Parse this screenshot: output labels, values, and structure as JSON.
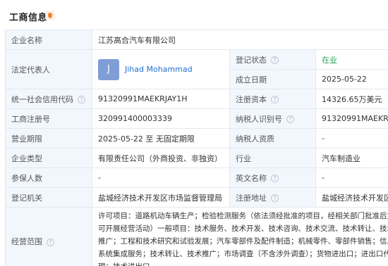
{
  "header": {
    "title": "工商信息",
    "icon": "info-badge-icon"
  },
  "rows": {
    "company_name": {
      "label": "企业名称",
      "value": "江苏高合汽车有限公司"
    },
    "legal_rep": {
      "label": "法定代表人",
      "avatar_letter": "J",
      "name": "Jihad Mohammad"
    },
    "reg_status": {
      "label": "登记状态",
      "value": "在业"
    },
    "established": {
      "label": "成立日期",
      "value": "2025-05-22"
    },
    "credit_code": {
      "label": "统一社会信用代码",
      "value": "91320991MAEKRJAY1H"
    },
    "reg_capital": {
      "label": "注册资本",
      "value": "14326.65万美元"
    },
    "reg_number": {
      "label": "工商注册号",
      "value": "320991400003339"
    },
    "taxpayer_id": {
      "label": "纳税人识别号",
      "value": "91320991MAEKRJAY1H"
    },
    "biz_term": {
      "label": "营业期限",
      "value": "2025-05-22 至 无固定期限"
    },
    "taxpayer_qual": {
      "label": "纳税人资质",
      "value": "-"
    },
    "company_type": {
      "label": "企业类型",
      "value": "有限责任公司（外商投资、非独资）"
    },
    "industry": {
      "label": "行业",
      "value": "汽车制造业"
    },
    "insured": {
      "label": "参保人数",
      "value": "-"
    },
    "english_name": {
      "label": "英文名称",
      "value": "-"
    },
    "reg_authority": {
      "label": "登记机关",
      "value": "盐城经济技术开发区市场监督管理局"
    },
    "reg_address": {
      "label": "注册地址",
      "value": "盐城经济技术开发区"
    },
    "biz_scope": {
      "label": "经营范围",
      "value": "许可项目：道路机动车辆生产；检验检测服务（依法须经批准的项目，经相关部门批准后方可开展经营活动）一般项目：技术服务、技术开发、技术咨询、技术交流、技术转让、技术推广；工程和技术研究和试验发展；汽车零部件及配件制造；机械零件、零部件销售；信息系统集成服务；技术转让、技术推广；市场调查（不含涉外调查）；货物进出口；进出口代理；技术进出口"
    }
  }
}
